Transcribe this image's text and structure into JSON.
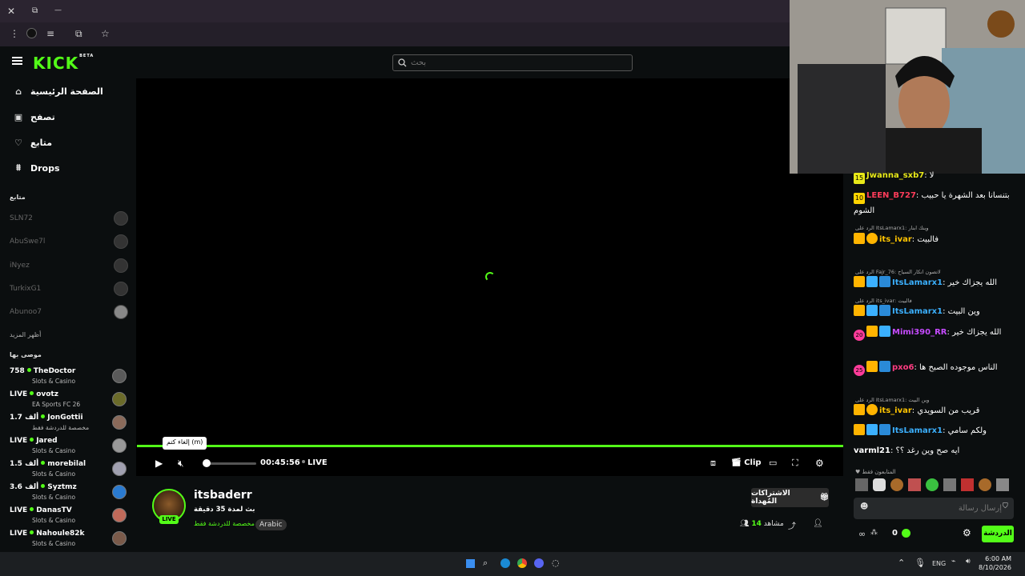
{
  "browser": {
    "close_icon": "✕",
    "restore_icon": "⧉",
    "minimize_icon": "—"
  },
  "brand": {
    "logo": "KICK",
    "beta": "BETA"
  },
  "search": {
    "placeholder": "بحث"
  },
  "nav": {
    "items": [
      {
        "label": "الصفحة الرئيسية"
      },
      {
        "label": "تصفح"
      },
      {
        "label": "متابع"
      },
      {
        "label": "Drops"
      }
    ]
  },
  "following": {
    "heading": "متابع",
    "items": [
      {
        "name": "SLN72"
      },
      {
        "name": "AbuSwe7l"
      },
      {
        "name": "iNyez"
      },
      {
        "name": "TurkixG1"
      },
      {
        "name": "Abunoo7"
      }
    ],
    "show_more": "أظهر المزيد"
  },
  "recommended": {
    "heading": "موصى بها",
    "items": [
      {
        "count": "758",
        "name": "TheDoctor",
        "category": "Slots & Casino"
      },
      {
        "count": "LIVE",
        "name": "ovotz",
        "category": "EA Sports FC 26"
      },
      {
        "count": "1.7 ألف",
        "name": "JonGottii",
        "category": "مخصصة للدردشة فقط"
      },
      {
        "count": "LIVE",
        "name": "Jared",
        "category": "Slots & Casino"
      },
      {
        "count": "1.5 ألف",
        "name": "morebilal",
        "category": "Slots & Casino"
      },
      {
        "count": "3.6 ألف",
        "name": "Syztmz",
        "category": "Slots & Casino"
      },
      {
        "count": "LIVE",
        "name": "DanasTV",
        "category": "Slots & Casino"
      },
      {
        "count": "LIVE",
        "name": "Nahoule82k",
        "category": "Slots & Casino"
      }
    ]
  },
  "player": {
    "tooltip": "إلغاء كتم (m)",
    "time": "00:45:56",
    "live": "LIVE",
    "clip": "Clip",
    "progress_fraction": 1.0
  },
  "stream": {
    "channel": "itsbaderr",
    "live_badge": "LIVE",
    "title": "بث لمدة 35 دقيقة",
    "tag_category": "مخصصة للدردشة فقط",
    "tag_language": "Arabic",
    "subs_button": "الاشتراكات المُهداة",
    "viewers_label": "مشاهد",
    "viewers": "14"
  },
  "chat": {
    "messages": [
      {
        "badge": "15",
        "user": "Jwanna_sxb7",
        "text": ": لا",
        "color": "#e8e818"
      },
      {
        "badge": "10",
        "user": "LEEN_B727",
        "text": ": بتنسانا بعد الشهرة يا حبيب الشوم",
        "color": "#ff3c5a"
      },
      {
        "reply": "الرد على ItsLamarx1: وينك ابنار",
        "user": "its_ivar",
        "text": ": فالبيت",
        "color": "#ffc400"
      },
      {
        "reply": "الرد على Fajr_76: لاتصون انكار السياح",
        "user": "ItsLamarx1",
        "text": ": الله يجزاك خير",
        "color": "#3bb0ff"
      },
      {
        "reply": "الرد على its_ivar: فالبيت",
        "user": "ItsLamarx1",
        "text": ": وين البيت",
        "color": "#3bb0ff"
      },
      {
        "badge": "20",
        "user": "Mimi390_RR",
        "text": ": الله يجزاك خير",
        "color": "#c64bff"
      },
      {
        "badge": "25",
        "user": "pxo6",
        "text": ": الناس موجوده الصبح ها",
        "color": "#ff3c82"
      },
      {
        "reply": "الرد على ItsLamarx1: وين البيت",
        "user": "its_ivar",
        "text": ": قريب من السويدي",
        "color": "#ffc400"
      },
      {
        "user": "ItsLamarx1",
        "text": ": ولكم سامي",
        "color": "#3bb0ff"
      },
      {
        "user": "varml21",
        "text": ": ايه صح وين رغد ؟؟",
        "color": "#ffffff"
      }
    ],
    "supporters_label": "المتابعون فقط",
    "input_placeholder": "إرسال رسالة",
    "points": "0",
    "send_button": "الدردشة"
  },
  "taskbar": {
    "lang": "ENG",
    "time": "6:00 AM",
    "date": "8/10/2026"
  }
}
